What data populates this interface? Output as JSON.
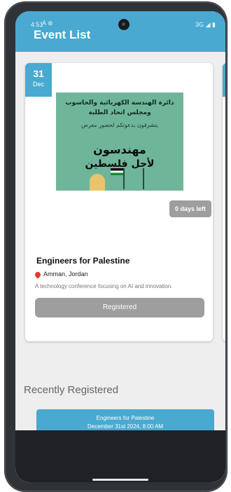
{
  "status_bar": {
    "time": "4:51",
    "indicators": "A ⊛",
    "network": "3G ◢ ▮"
  },
  "app": {
    "title": "Event List"
  },
  "event_card": {
    "day": "31",
    "month": "Dec",
    "poster_lines": [
      "دائرة الهندسة الكهربائية والحاسوب",
      "ومجلس اتحاد الطلبة",
      "يتشرفون بدعوتكم لحضور معرض",
      "مهندسون",
      "لأجل فلسطين"
    ],
    "days_left": "0 days left",
    "title": "Engineers for Palestine",
    "location": "Amman, Jordan",
    "description": "A technology conference focusing on AI and innovation.",
    "button_label": "Registered"
  },
  "recent": {
    "heading": "Recently Registered",
    "items": [
      {
        "title": "Engineers for Palestine",
        "datetime": "December 31st 2024, 8:00 AM"
      }
    ]
  },
  "colors": {
    "accent": "#4aa9d0",
    "button_disabled": "#9e9e9e",
    "pin": "#e53935"
  },
  "icons": {
    "location": "location-pin-icon"
  }
}
